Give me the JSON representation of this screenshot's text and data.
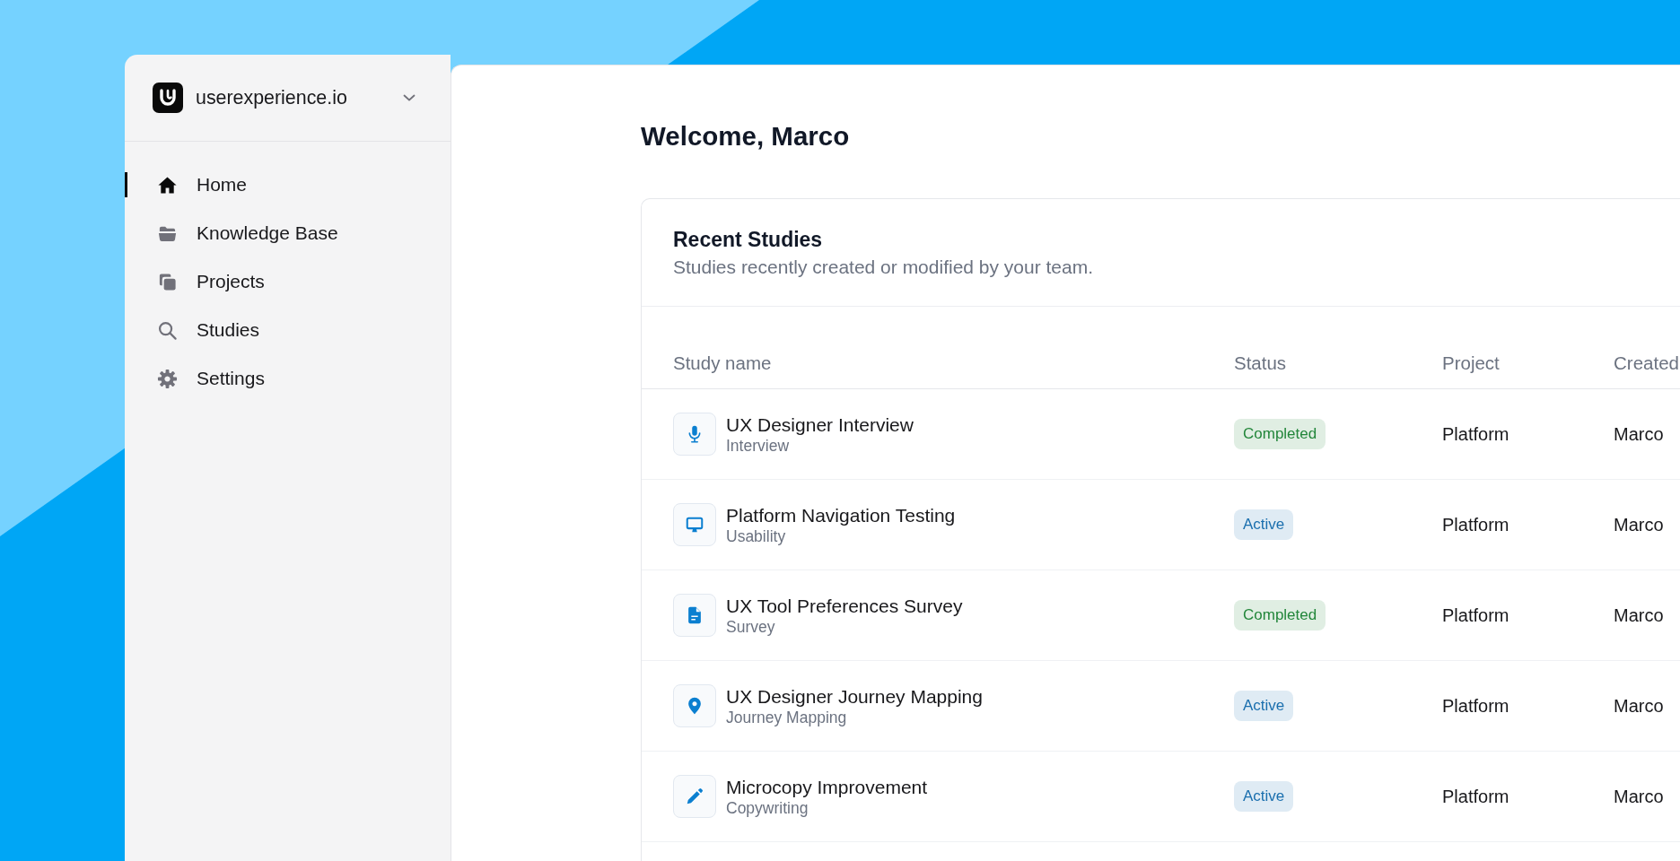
{
  "workspace": {
    "name": "userexperience.io"
  },
  "sidebar": {
    "items": [
      {
        "label": "Home",
        "kind": "home",
        "selected": true
      },
      {
        "label": "Knowledge Base",
        "kind": "knowledge",
        "selected": false
      },
      {
        "label": "Projects",
        "kind": "projects",
        "selected": false
      },
      {
        "label": "Studies",
        "kind": "studies",
        "selected": false
      },
      {
        "label": "Settings",
        "kind": "settings",
        "selected": false
      }
    ]
  },
  "main": {
    "greeting": "Welcome, Marco"
  },
  "recent_studies": {
    "title": "Recent Studies",
    "subtitle": "Studies recently created or modified by your team.",
    "columns": [
      "Study name",
      "Status",
      "Project",
      "Created"
    ],
    "rows": [
      {
        "name": "UX Designer Interview",
        "type": "Interview",
        "kind": "interview",
        "status": {
          "label": "Completed",
          "color": "#22863a"
        },
        "project": "Platform",
        "created": "Marco"
      },
      {
        "name": "Platform Navigation Testing",
        "type": "Usability",
        "kind": "usability",
        "status": {
          "label": "Active",
          "color": "#1a6fae"
        },
        "project": "Platform",
        "created": "Marco"
      },
      {
        "name": "UX Tool Preferences Survey",
        "type": "Survey",
        "kind": "survey",
        "status": {
          "label": "Completed",
          "color": "#22863a"
        },
        "project": "Platform",
        "created": "Marco"
      },
      {
        "name": "UX Designer Journey Mapping",
        "type": "Journey Mapping",
        "kind": "journey",
        "status": {
          "label": "Active",
          "color": "#1a6fae"
        },
        "project": "Platform",
        "created": "Marco"
      },
      {
        "name": "Microcopy Improvement",
        "type": "Copywriting",
        "kind": "copywriting",
        "status": {
          "label": "Active",
          "color": "#1a6fae"
        },
        "project": "Platform",
        "created": "Marco"
      }
    ]
  }
}
